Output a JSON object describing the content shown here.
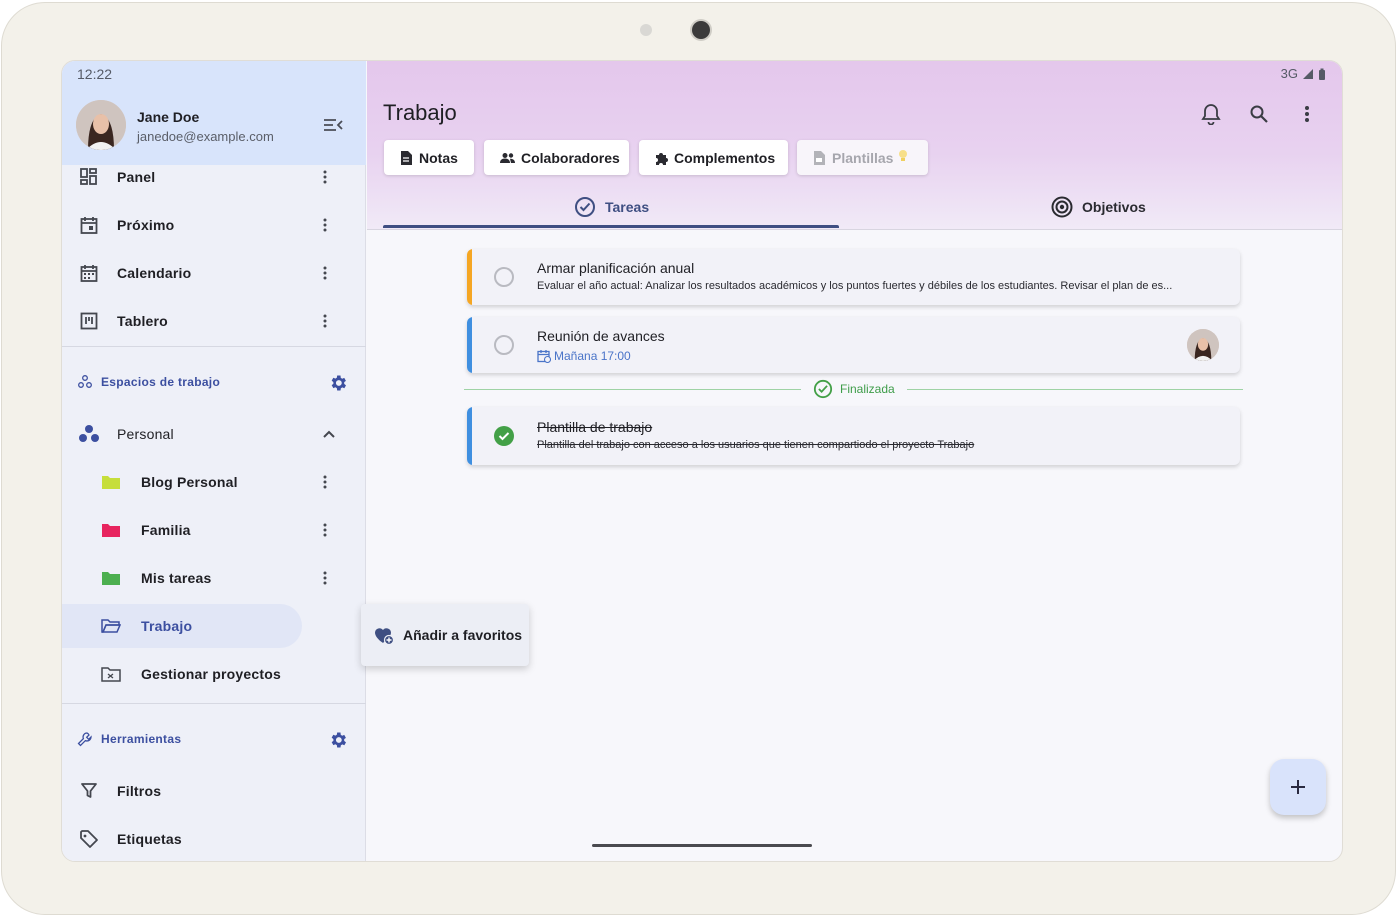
{
  "status": {
    "time": "12:22",
    "network": "3G"
  },
  "user": {
    "name": "Jane Doe",
    "email": "janedoe@example.com"
  },
  "nav": [
    {
      "label": "Panel"
    },
    {
      "label": "Próximo"
    },
    {
      "label": "Calendario"
    },
    {
      "label": "Tablero"
    }
  ],
  "workspaces": {
    "title": "Espacios de trabajo",
    "group": "Personal",
    "items": [
      {
        "label": "Blog Personal",
        "color": "#c6de3b"
      },
      {
        "label": "Familia",
        "color": "#e7245f"
      },
      {
        "label": "Mis tareas",
        "color": "#4caf50"
      },
      {
        "label": "Trabajo"
      },
      {
        "label": "Gestionar proyectos"
      }
    ]
  },
  "tools": {
    "title": "Herramientas",
    "items": [
      {
        "label": "Filtros"
      },
      {
        "label": "Etiquetas"
      }
    ]
  },
  "context_menu": {
    "label": "Añadir a favoritos"
  },
  "main": {
    "title": "Trabajo",
    "chips": [
      {
        "label": "Notas"
      },
      {
        "label": "Colaboradores"
      },
      {
        "label": "Complementos"
      },
      {
        "label": "Plantillas"
      }
    ],
    "tabs": [
      {
        "label": "Tareas"
      },
      {
        "label": "Objetivos"
      }
    ]
  },
  "tasks": [
    {
      "title": "Armar planificación anual",
      "description": "Evaluar el año actual: Analizar los resultados académicos y los puntos fuertes y débiles de los estudiantes. Revisar el plan de es...",
      "color": "#f5a623"
    },
    {
      "title": "Reunión de avances",
      "date": "Mañana 17:00",
      "color": "#3f8fe0"
    }
  ],
  "separator": {
    "label": "Finalizada"
  },
  "done_tasks": [
    {
      "title": "Plantilla de trabajo",
      "description": "Plantilla del trabajo con acceso a los usuarios que tienen compartiodo el proyecto Trabajo",
      "color": "#3f8fe0"
    }
  ],
  "colors": {
    "accent": "#3c4fa0",
    "done": "#43a047"
  }
}
